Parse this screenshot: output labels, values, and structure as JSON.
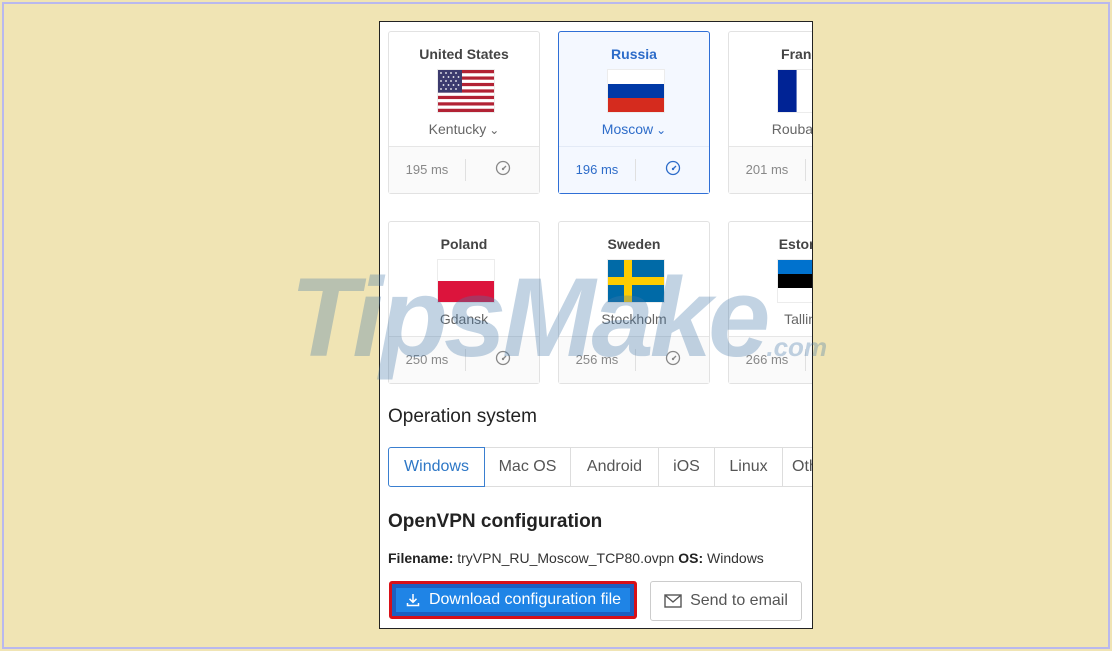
{
  "servers": [
    {
      "country": "United States",
      "city": "Kentucky",
      "ping": "195 ms",
      "flag": "us-flag",
      "selected": false
    },
    {
      "country": "Russia",
      "city": "Moscow",
      "ping": "196 ms",
      "flag": "russia-flag",
      "selected": true
    },
    {
      "country": "France",
      "city": "Roubaix",
      "ping": "201 ms",
      "flag": "france-flag",
      "selected": false
    },
    {
      "country": "Poland",
      "city": "Gdansk",
      "ping": "250 ms",
      "flag": "poland-flag",
      "selected": false
    },
    {
      "country": "Sweden",
      "city": "Stockholm",
      "ping": "256 ms",
      "flag": "sweden-flag",
      "selected": false
    },
    {
      "country": "Estonia",
      "city": "Tallinn",
      "ping": "266 ms",
      "flag": "estonia-flag",
      "selected": false
    }
  ],
  "os_section": {
    "title": "Operation system",
    "tabs": [
      "Windows",
      "Mac OS",
      "Android",
      "iOS",
      "Linux",
      "Other"
    ],
    "active": "Windows"
  },
  "config": {
    "title": "OpenVPN configuration",
    "filename_label": "Filename:",
    "filename": "tryVPN_RU_Moscow_TCP80.ovpn",
    "os_label": "OS:",
    "os_value": "Windows",
    "download_label": "Download configuration file",
    "email_label": "Send to email"
  },
  "watermark": {
    "main": "TipsMake",
    "suffix": ".com"
  },
  "colors": {
    "accent": "#2d6cc9",
    "download_bg": "#1f84e6",
    "highlight": "#d81018",
    "background": "#f0e4b4"
  }
}
